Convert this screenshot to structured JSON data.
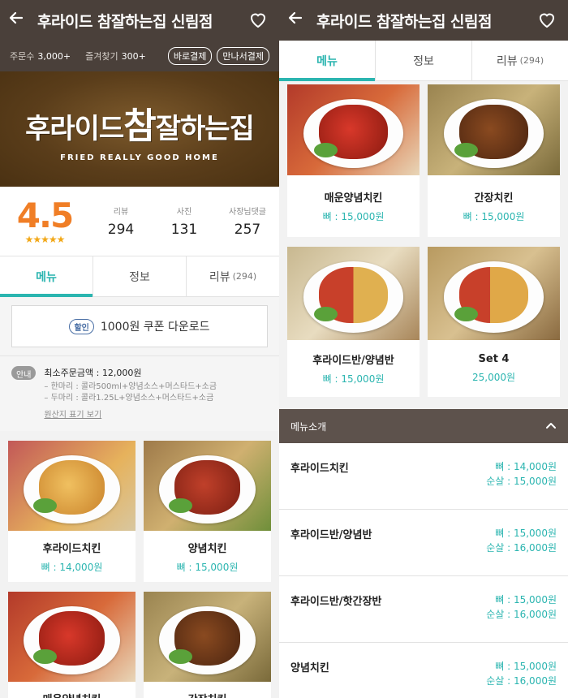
{
  "store": {
    "title": "후라이드 참잘하는집 신림점",
    "order_label": "주문수",
    "order_count": "3,000+",
    "fav_label": "즐겨찾기",
    "fav_count": "300+",
    "pay_now": "바로결제",
    "pay_meet": "만나서결제"
  },
  "banner": {
    "logo_pre": "후라이드",
    "logo_big": "참",
    "logo_post": "잘하는집",
    "logo_en": "FRIED REALLY GOOD HOME"
  },
  "rating": {
    "score": "4.5",
    "stars": "★★★★★",
    "review_label": "리뷰",
    "review_value": "294",
    "photo_label": "사진",
    "photo_value": "131",
    "reply_label": "사장님댓글",
    "reply_value": "257"
  },
  "tabs": {
    "menu": "메뉴",
    "info": "정보",
    "review": "리뷰",
    "review_count": "(294)"
  },
  "coupon": {
    "tag": "할인",
    "text": "1000원 쿠폰 다운로드"
  },
  "notice": {
    "badge": "안내",
    "min_order": "최소주문금액 : 12,000원",
    "line1": "– 한마리 : 콜라500ml+양념소스+머스타드+소금",
    "line2": "– 두마리 : 콜라1.25L+양념소스+머스타드+소금",
    "link": "원산지 표기 보기"
  },
  "left_menu": [
    {
      "name": "후라이드치킨",
      "price": "뼈 : 14,000원"
    },
    {
      "name": "양념치킨",
      "price": "뼈 : 15,000원"
    }
  ],
  "right_menu": [
    {
      "name": "매운양념치킨",
      "price": "뼈 : 15,000원"
    },
    {
      "name": "간장치킨",
      "price": "뼈 : 15,000원"
    },
    {
      "name": "후라이드반/양념반",
      "price": "뼈 : 15,000원"
    },
    {
      "name": "Set 4",
      "price": "25,000원"
    }
  ],
  "section": {
    "title": "메뉴소개",
    "chevron": "chevron-up-icon"
  },
  "menu_list": [
    {
      "name": "후라이드치킨",
      "price1": "뼈 : 14,000원",
      "price2": "순살 : 15,000원"
    },
    {
      "name": "후라이드반/양념반",
      "price1": "뼈 : 15,000원",
      "price2": "순살 : 16,000원"
    },
    {
      "name": "후라이드반/핫간장반",
      "price1": "뼈 : 15,000원",
      "price2": "순살 : 16,000원"
    },
    {
      "name": "양념치킨",
      "price1": "뼈 : 15,000원",
      "price2": "순살 : 16,000원"
    }
  ],
  "colors": {
    "header": "#4a403a",
    "accent": "#2bb5b0",
    "rating": "#f07e26",
    "section": "#5d524c"
  },
  "icons": [
    "back-arrow-icon",
    "heart-icon",
    "chevron-up-icon"
  ]
}
